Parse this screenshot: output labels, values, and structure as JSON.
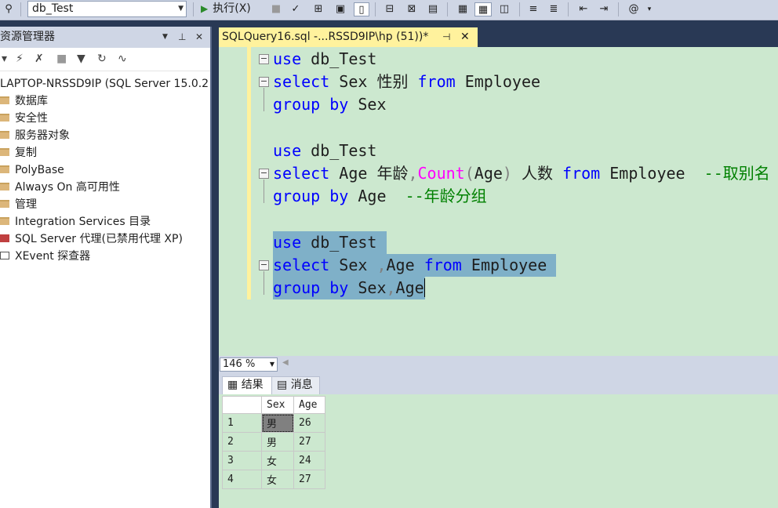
{
  "toolbar": {
    "database": "db_Test",
    "execute_label": "执行(X)"
  },
  "object_explorer": {
    "title": "资源管理器",
    "server": "LAPTOP-NRSSD9IP (SQL Server 15.0.2",
    "items": [
      "数据库",
      "安全性",
      "服务器对象",
      "复制",
      "PolyBase",
      "Always On 高可用性",
      "管理",
      "Integration Services 目录",
      "SQL Server 代理(已禁用代理 XP)",
      "XEvent 探查器"
    ]
  },
  "editor": {
    "tab_title": "SQLQuery16.sql -...RSSD9IP\\hp (51))*",
    "zoom": "146 %",
    "lines": {
      "l1_kw": "use",
      "l1_rest": " db_Test",
      "l2_kw": "select",
      "l2_rest": " Sex 性别 ",
      "l2_from": "from",
      "l2_tbl": " Employee",
      "l3_kw": "group by",
      "l3_rest": " Sex",
      "l5_kw": "use",
      "l5_rest": " db_Test",
      "l6_kw": "select",
      "l6_a": " Age 年龄",
      "l6_comma": ",",
      "l6_fn": "Count",
      "l6_paren_open": "(",
      "l6_arg": "Age",
      "l6_paren_close": ")",
      "l6_b": " 人数 ",
      "l6_from": "from",
      "l6_tbl": " Employee  ",
      "l6_cm": "--取别名",
      "l7_kw": "group by",
      "l7_rest": " Age  ",
      "l7_cm": "--年龄分组",
      "l9_kw": "use",
      "l9_rest": " db_Test ",
      "l10_kw": "select",
      "l10_a": " Sex ",
      "l10_comma": ",",
      "l10_b": "Age ",
      "l10_from": "from",
      "l10_tbl": " Employee ",
      "l11_kw": "group by",
      "l11_a": " Sex",
      "l11_comma": ",",
      "l11_b": "Age"
    }
  },
  "results": {
    "tab_results": "结果",
    "tab_messages": "消息",
    "columns": [
      "Sex",
      "Age"
    ],
    "rows": [
      {
        "n": "1",
        "sex": "男",
        "age": "26"
      },
      {
        "n": "2",
        "sex": "男",
        "age": "27"
      },
      {
        "n": "3",
        "sex": "女",
        "age": "24"
      },
      {
        "n": "4",
        "sex": "女",
        "age": "27"
      }
    ]
  }
}
